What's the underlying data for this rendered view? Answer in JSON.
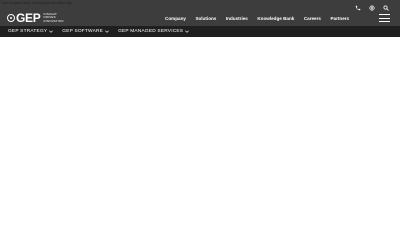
{
  "browser_notice": "Your browser does not support the video tag.",
  "logo": {
    "wordmark": "GEP",
    "tagline": [
      "INSIGHT",
      "DRIVES",
      "INNOVATION"
    ]
  },
  "utility_icons": [
    "phone-icon",
    "globe-icon",
    "search-icon"
  ],
  "main_nav": {
    "items": [
      {
        "label": "Company"
      },
      {
        "label": "Solutions"
      },
      {
        "label": "Industries"
      },
      {
        "label": "Knowledge Bank"
      },
      {
        "label": "Careers"
      },
      {
        "label": "Partners"
      }
    ]
  },
  "sub_nav": {
    "items": [
      {
        "label": "GEP STRATEGY"
      },
      {
        "label": "GEP SOFTWARE"
      },
      {
        "label": "GEP MANAGED SERVICES"
      }
    ]
  },
  "colors": {
    "header_bg": "#3d3d3d",
    "subnav_bg": "#1f1f1f",
    "text_light": "#ffffff",
    "page_bg": "#ffffff"
  }
}
